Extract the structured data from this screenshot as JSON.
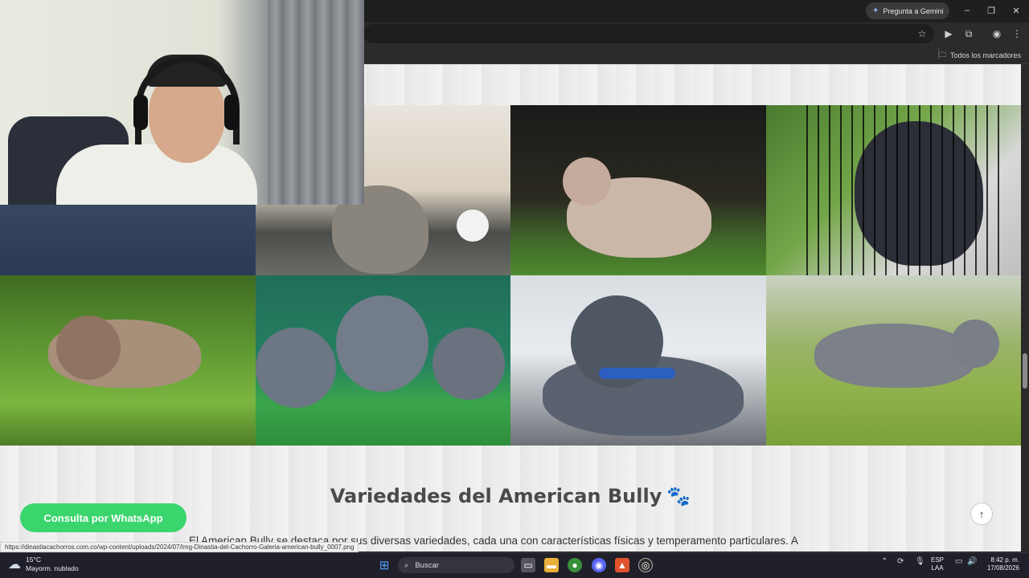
{
  "browser": {
    "gemini_label": "Pregunta a Gemini",
    "bookmarks_all": "Todos los marcadores"
  },
  "page": {
    "section_title": "Variedades del American Bully",
    "section_paw": "🐾",
    "paragraph": "El American Bully se destaca por sus diversas variedades, cada una con características físicas y temperamento particulares. A continuación se",
    "whatsapp_label": "Consulta por WhatsApp",
    "status_url": "https://dinastiacachorros.com.co/wp-content/uploads/2024/07/Img-Dinastia-del-Cachorro-Galeria-american-bully_0007.png"
  },
  "taskbar": {
    "temperature": "15°C",
    "weather_desc": "Mayorm. nublado",
    "search_placeholder": "Buscar",
    "lang_top": "ESP",
    "lang_bottom": "LAA",
    "time": "8:42 p. m.",
    "date": "17/08/2026"
  },
  "colors": {
    "whatsapp": "#3bd56e",
    "title": "#4a4a4a",
    "paw": "#d4a860"
  },
  "icons": {
    "gemini": "sparkle-icon",
    "scroll_top": "arrow-up-icon",
    "weather": "cloud-icon"
  }
}
